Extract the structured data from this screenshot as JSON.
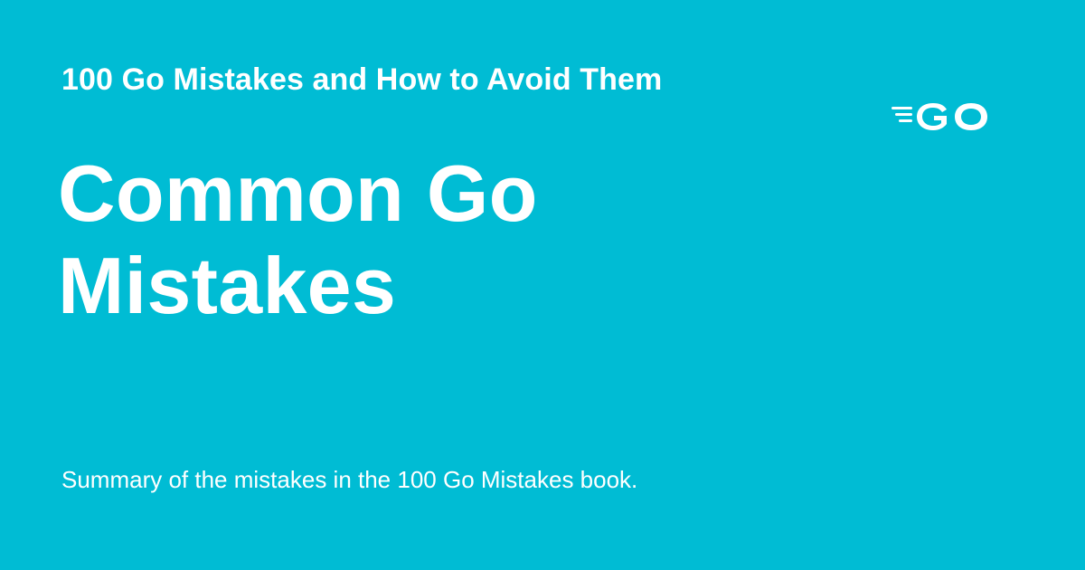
{
  "card": {
    "background_color": "#00bcd4",
    "text_color": "#ffffff",
    "site_name": "100 Go Mistakes and How to Avoid Them",
    "title": "Common Go Mistakes",
    "description": "Summary of the mistakes in the 100 Go Mistakes book.",
    "logo": {
      "icon": "go-logo-icon",
      "text": "GO"
    }
  }
}
